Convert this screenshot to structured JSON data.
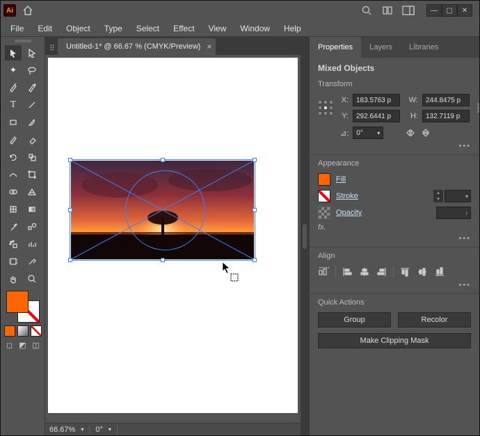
{
  "menu": [
    "File",
    "Edit",
    "Object",
    "Type",
    "Select",
    "Effect",
    "View",
    "Window",
    "Help"
  ],
  "doc_tab": "Untitled-1* @ 66.67 % (CMYK/Preview)",
  "status": {
    "zoom": "66.67%",
    "rotation": "0°"
  },
  "panel_tabs": [
    "Properties",
    "Layers",
    "Libraries"
  ],
  "selection_label": "Mixed Objects",
  "transform": {
    "head": "Transform",
    "x_label": "X:",
    "x": "183.5763 p",
    "y_label": "Y:",
    "y": "292.6441 p",
    "w_label": "W:",
    "w": "244.8475 p",
    "h_label": "H:",
    "h": "132.7119 p",
    "angle": "0°"
  },
  "appearance": {
    "head": "Appearance",
    "fill": "Fill",
    "stroke": "Stroke",
    "opacity": "Opacity",
    "fx": "fx."
  },
  "align": {
    "head": "Align"
  },
  "quick": {
    "head": "Quick Actions",
    "group": "Group",
    "recolor": "Recolor",
    "mask": "Make Clipping Mask"
  },
  "fill_color": "#ff6600"
}
